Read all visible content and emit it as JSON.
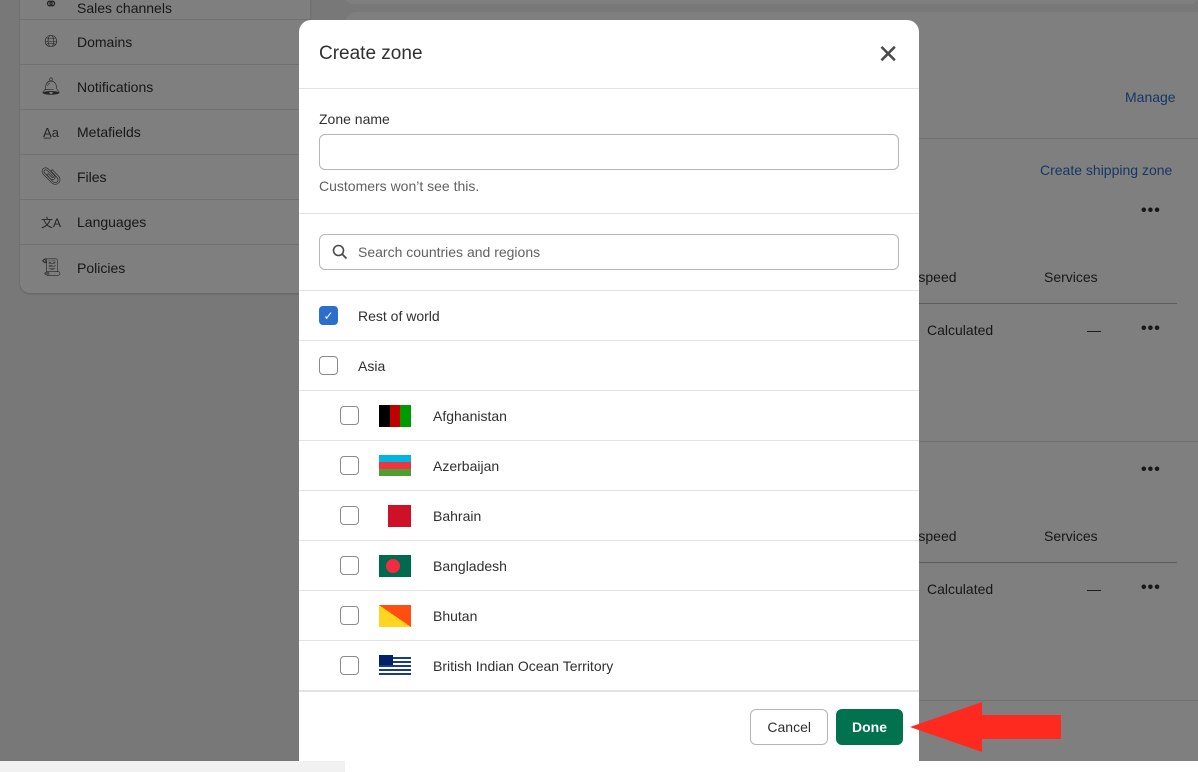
{
  "sidebar": {
    "items": [
      {
        "label": "Sales channels",
        "icon": "sales-channels-icon",
        "glyph": "⚭"
      },
      {
        "label": "Domains",
        "icon": "globe-icon",
        "glyph": "🌐︎"
      },
      {
        "label": "Notifications",
        "icon": "bell-icon",
        "glyph": "🔔︎"
      },
      {
        "label": "Metafields",
        "icon": "metafields-icon",
        "glyph": "A̲a"
      },
      {
        "label": "Files",
        "icon": "paperclip-icon",
        "glyph": "📎︎"
      },
      {
        "label": "Languages",
        "icon": "translate-icon",
        "glyph": "文A"
      },
      {
        "label": "Policies",
        "icon": "policy-icon",
        "glyph": "📜︎"
      }
    ]
  },
  "background": {
    "manage_link": "Manage",
    "create_zone_link": "Create shipping zone",
    "col_speed": "Shipping speed",
    "col_services": "Services",
    "calculated": "Calculated",
    "dash": "—"
  },
  "modal": {
    "title": "Create zone",
    "zone_name_label": "Zone name",
    "zone_name_value": "",
    "zone_name_help": "Customers won’t see this.",
    "search_placeholder": "Search countries and regions",
    "rest_of_world": {
      "label": "Rest of world",
      "checked": true
    },
    "asia": {
      "label": "Asia",
      "checked": false
    },
    "countries": [
      {
        "name": "Afghanistan",
        "checked": false
      },
      {
        "name": "Azerbaijan",
        "checked": false
      },
      {
        "name": "Bahrain",
        "checked": false
      },
      {
        "name": "Bangladesh",
        "checked": false
      },
      {
        "name": "Bhutan",
        "checked": false
      },
      {
        "name": "British Indian Ocean Territory",
        "checked": false
      }
    ],
    "cancel_label": "Cancel",
    "done_label": "Done"
  },
  "colors": {
    "primary": "#00724e",
    "link": "#2c6ecb",
    "checkbox": "#2c6ecb",
    "annotation_arrow": "#ff2a1f"
  }
}
